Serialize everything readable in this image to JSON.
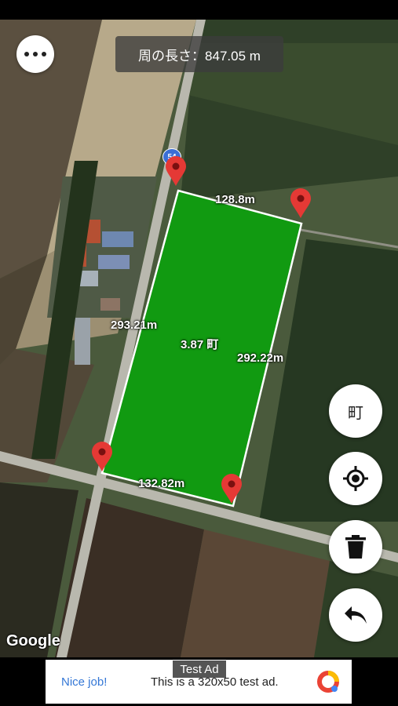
{
  "header": {
    "perimeter_label": "周の長さ：847.05 m"
  },
  "map": {
    "road_number": "54",
    "area_label": "3.87 町",
    "edges": {
      "top": "128.8m",
      "left": "293.21m",
      "right": "292.22m",
      "bottom": "132.82m"
    },
    "attribution": "Google",
    "field_color": "#119a11",
    "pin_color": "#e53935"
  },
  "controls": {
    "menu_icon": "more-horiz-icon",
    "unit_button": "町",
    "locate_icon": "my-location-icon",
    "delete_icon": "trash-icon",
    "undo_icon": "undo-icon"
  },
  "ad": {
    "badge": "Test Ad",
    "nice_job": "Nice job!",
    "text": "This is a 320x50 test ad."
  }
}
